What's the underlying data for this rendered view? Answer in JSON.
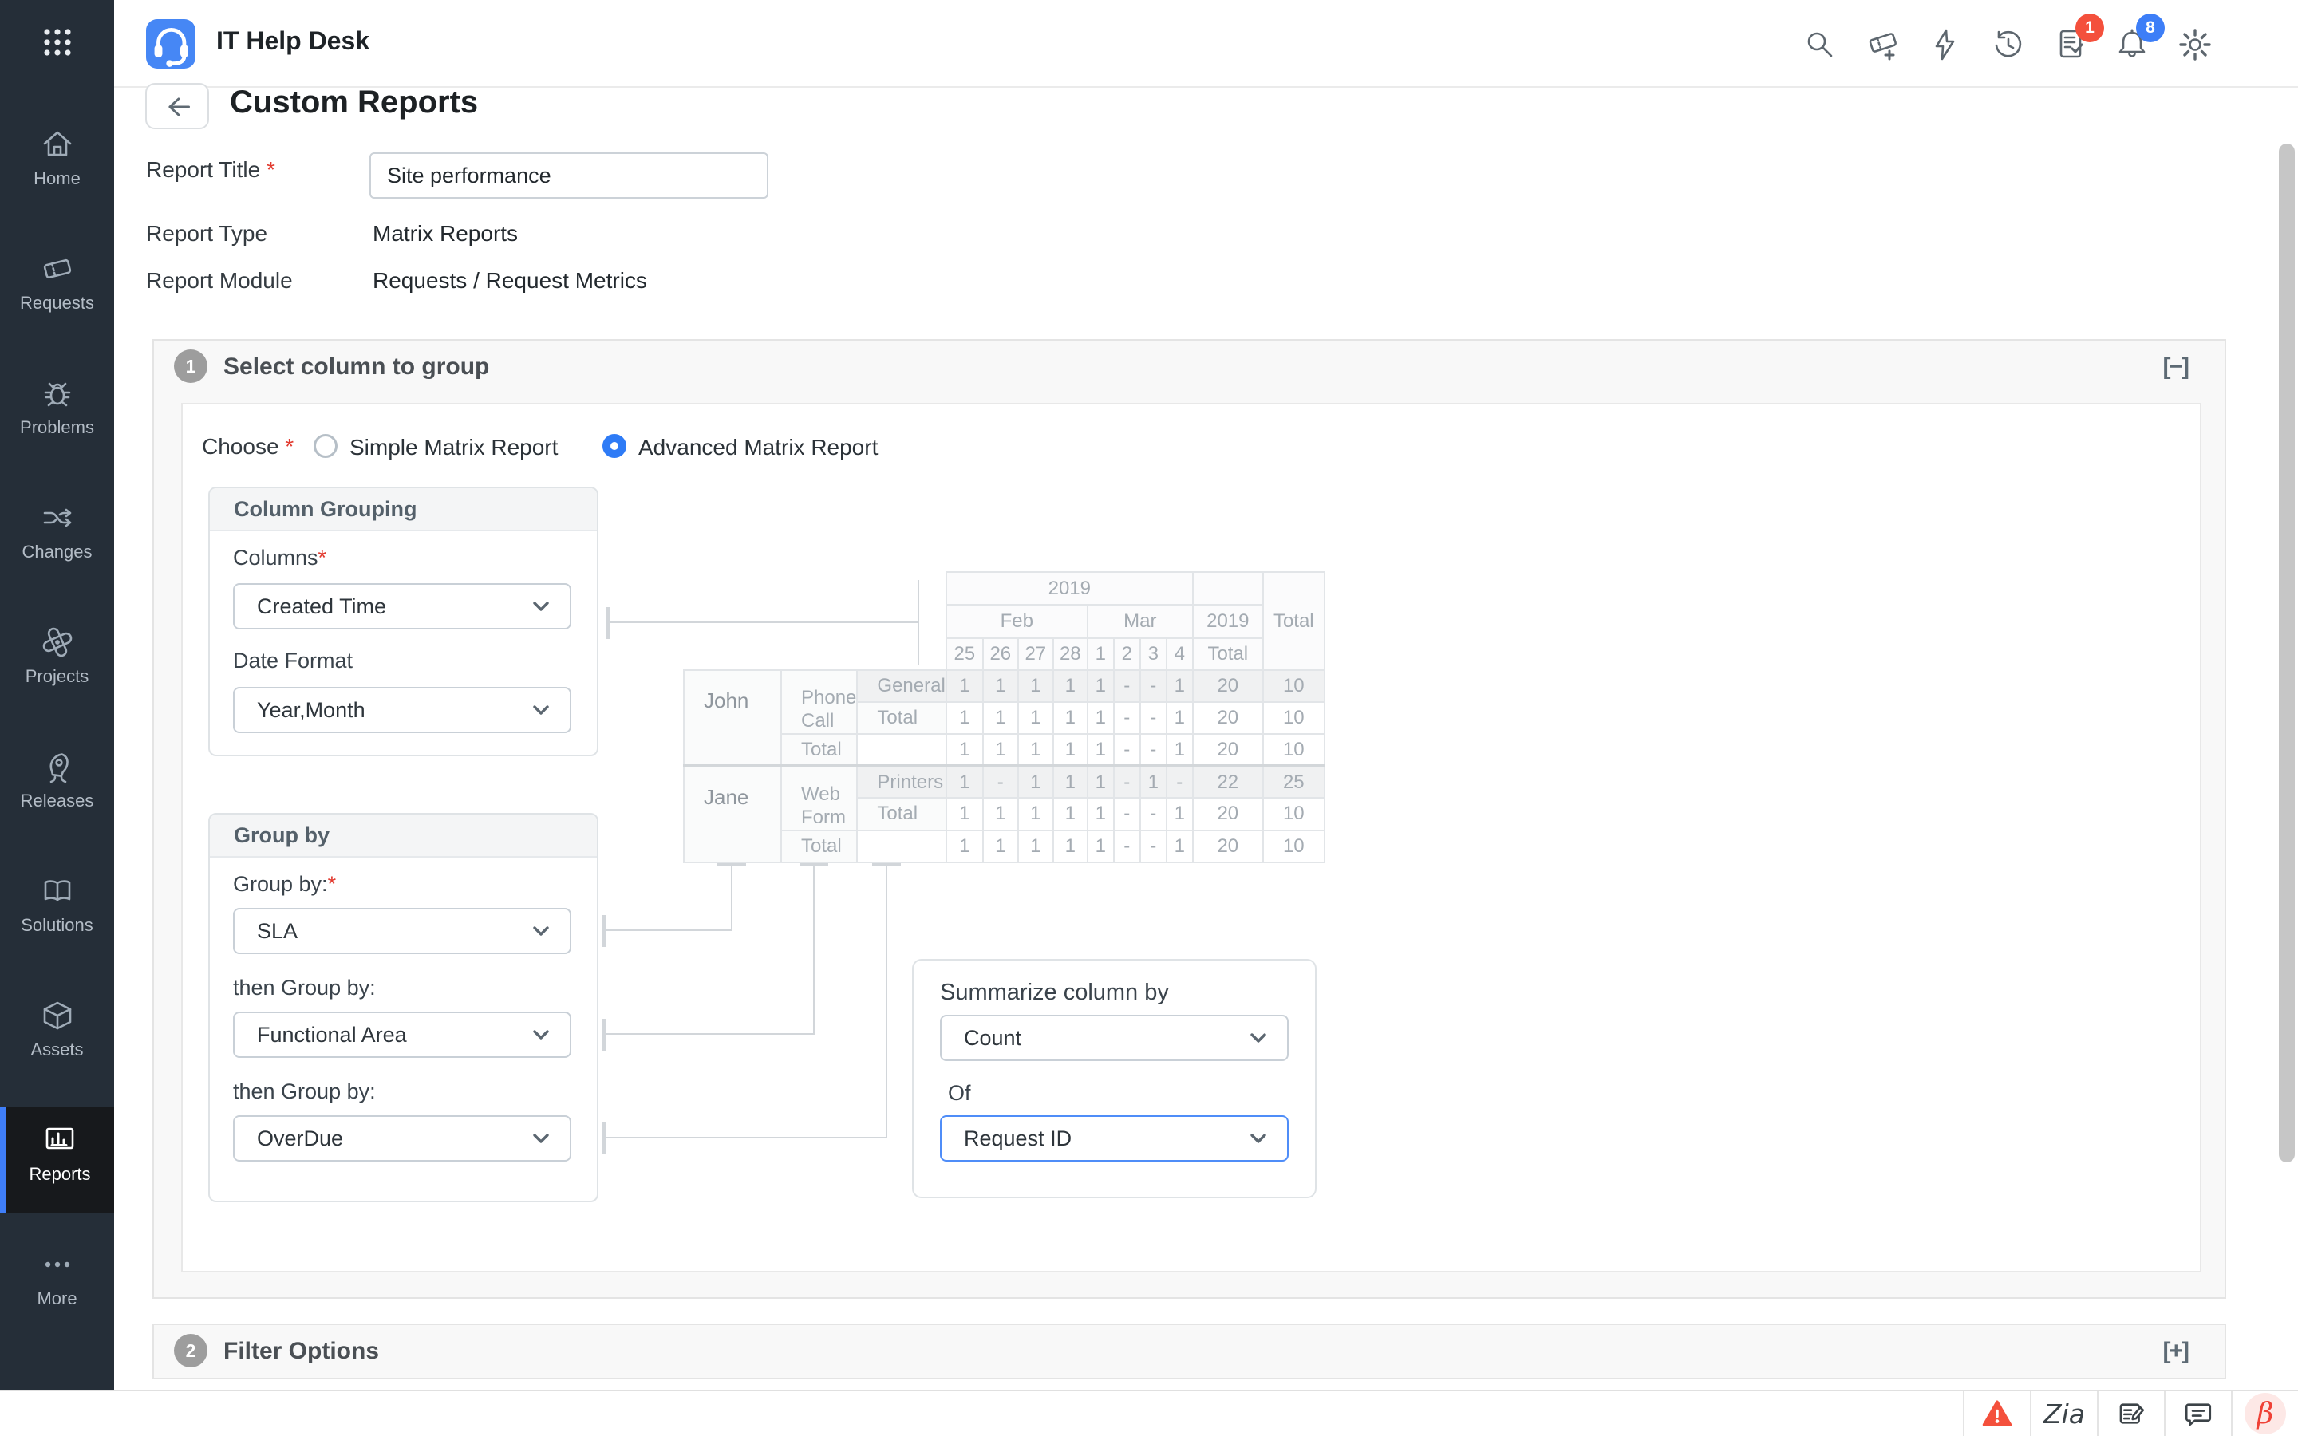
{
  "topbar": {
    "app_title": "IT Help Desk",
    "icons": [
      "search",
      "add-ticket",
      "quick-actions",
      "history",
      "tasks",
      "notifications",
      "settings"
    ],
    "badges": {
      "tasks": "1",
      "notifications": "8"
    }
  },
  "sidebar": {
    "items": [
      {
        "label": "Home",
        "icon": "home",
        "active": false
      },
      {
        "label": "Requests",
        "icon": "requests",
        "active": false
      },
      {
        "label": "Problems",
        "icon": "problems",
        "active": false
      },
      {
        "label": "Changes",
        "icon": "changes",
        "active": false
      },
      {
        "label": "Projects",
        "icon": "projects",
        "active": false
      },
      {
        "label": "Releases",
        "icon": "releases",
        "active": false
      },
      {
        "label": "Solutions",
        "icon": "solutions",
        "active": false
      },
      {
        "label": "Assets",
        "icon": "assets",
        "active": false
      },
      {
        "label": "Reports",
        "icon": "reports",
        "active": true
      },
      {
        "label": "More",
        "icon": "more",
        "active": false
      }
    ]
  },
  "page": {
    "title": "Custom Reports"
  },
  "form": {
    "report_title_label": "Report Title",
    "report_title_value": "Site performance",
    "report_type_label": "Report Type",
    "report_type_value": "Matrix Reports",
    "report_module_label": "Report Module",
    "report_module_value": "Requests / Request Metrics"
  },
  "section1": {
    "number": "1",
    "title": "Select column to group",
    "collapse_glyph": "[−]",
    "choose": {
      "label": "Choose",
      "option1": "Simple Matrix Report",
      "option2": "Advanced Matrix Report",
      "selected": "Advanced Matrix Report"
    },
    "column_grouping": {
      "title": "Column Grouping",
      "columns_label": "Columns",
      "columns_value": "Created Time",
      "date_format_label": "Date Format",
      "date_format_value": "Year,Month"
    },
    "group_by": {
      "title": "Group by",
      "label1": "Group by:",
      "value1": "SLA",
      "label2": "then Group by:",
      "value2": "Functional Area",
      "label3": "then Group by:",
      "value3": "OverDue"
    },
    "summarize": {
      "title": "Summarize column by",
      "by_value": "Count",
      "of_label": "Of",
      "of_value": "Request ID"
    }
  },
  "preview_table": {
    "year_header": "2019",
    "months": [
      {
        "label": "Feb",
        "span": 4
      },
      {
        "label": "Mar",
        "span": 4
      }
    ],
    "dates": [
      "25",
      "26",
      "27",
      "28",
      "1",
      "2",
      "3",
      "4"
    ],
    "year_total_header": "2019",
    "year_total_sub": "Total",
    "grand_total_header": "Total",
    "groups": [
      {
        "name": "John",
        "channel": "Phone Call",
        "detail_rows": [
          {
            "label": "General",
            "values": [
              "1",
              "1",
              "1",
              "1",
              "1",
              "-",
              "-",
              "1"
            ],
            "year_total": "20",
            "grand_total": "10",
            "shaded": true
          },
          {
            "label": "Total",
            "values": [
              "1",
              "1",
              "1",
              "1",
              "1",
              "-",
              "-",
              "1"
            ],
            "year_total": "20",
            "grand_total": "10",
            "shaded": false
          }
        ],
        "total_row": {
          "label": "Total",
          "values": [
            "1",
            "1",
            "1",
            "1",
            "1",
            "-",
            "-",
            "1"
          ],
          "year_total": "20",
          "grand_total": "10"
        }
      },
      {
        "name": "Jane",
        "channel": "Web Form",
        "detail_rows": [
          {
            "label": "Printers",
            "values": [
              "1",
              "-",
              "1",
              "1",
              "1",
              "-",
              "1",
              "-"
            ],
            "year_total": "22",
            "grand_total": "25",
            "shaded": true
          },
          {
            "label": "Total",
            "values": [
              "1",
              "1",
              "1",
              "1",
              "1",
              "-",
              "-",
              "1"
            ],
            "year_total": "20",
            "grand_total": "10",
            "shaded": false
          }
        ],
        "total_row": {
          "label": "Total",
          "values": [
            "1",
            "1",
            "1",
            "1",
            "1",
            "-",
            "-",
            "1"
          ],
          "year_total": "20",
          "grand_total": "10"
        }
      }
    ]
  },
  "section2": {
    "number": "2",
    "title": "Filter Options",
    "expand_glyph": "[+]"
  },
  "footer": {
    "icons": [
      "alert",
      "zia",
      "feedback",
      "chat",
      "beta"
    ]
  }
}
